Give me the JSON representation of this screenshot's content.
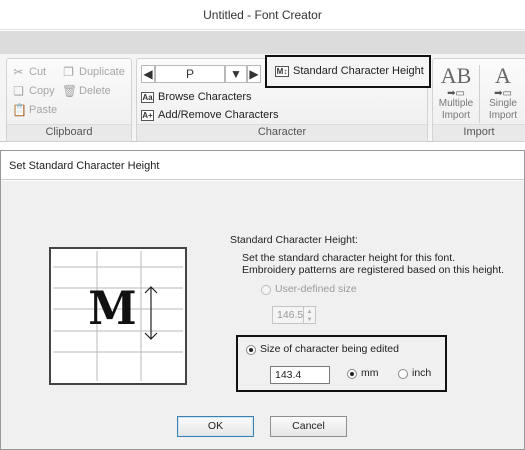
{
  "window": {
    "title": "Untitled - Font Creator"
  },
  "ribbon": {
    "clipboard": {
      "label": "Clipboard",
      "cut": "Cut",
      "duplicate": "Duplicate",
      "copy": "Copy",
      "delete": "Delete",
      "paste": "Paste"
    },
    "character": {
      "label": "Character",
      "current_char": "P",
      "standard_height": "Standard Character Height",
      "browse": "Browse Characters",
      "add_remove": "Add/Remove Characters"
    },
    "import": {
      "label": "Import",
      "multiple_line1": "Multiple",
      "multiple_line2": "Import",
      "single_line1": "Single",
      "single_line2": "Import",
      "multiple_glyph": "AB",
      "single_glyph": "A"
    }
  },
  "dialog": {
    "title": "Set Standard Character Height",
    "heading": "Standard Character Height:",
    "desc_line1": "Set the standard character height for this font.",
    "desc_line2": "Embroidery patterns are registered based on this height.",
    "illustration_letter": "M",
    "user_defined_label": "User-defined size",
    "user_defined_value": "146.5",
    "edited_label": "Size of character being edited",
    "edited_value": "143.4",
    "unit_mm": "mm",
    "unit_inch": "inch",
    "ok": "OK",
    "cancel": "Cancel"
  }
}
